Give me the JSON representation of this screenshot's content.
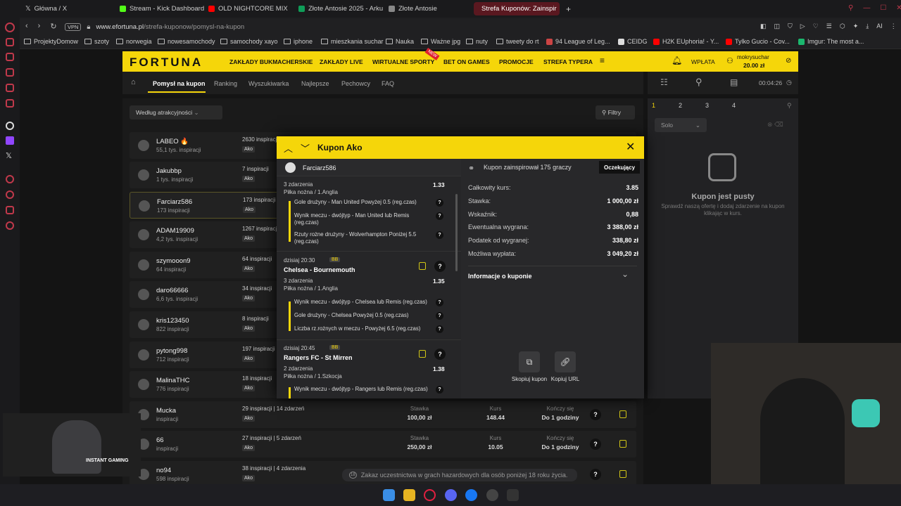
{
  "browser": {
    "tabs": [
      {
        "label": "Główna / X",
        "color": "#ffffff"
      },
      {
        "label": "Stream - Kick Dashboard",
        "color": "#53fc18"
      },
      {
        "label": "OLD NIGHTCORE MIX",
        "color": "#ff0000"
      },
      {
        "label": "Złote Antosie 2025 - Arku",
        "color": "#0f9d58"
      },
      {
        "label": "Złote Antosie",
        "color": "#888888"
      },
      {
        "label": "Strefa Kuponów: Zainspir",
        "color": "#e02020"
      }
    ],
    "new_tab": "+",
    "vpn": "VPN",
    "url_domain": "www.efortuna.pl",
    "url_path": "/strefa-kuponow/pomysl-na-kupon",
    "ai_label": "AI",
    "bookmarks": [
      "ProjektyDomow",
      "szoty",
      "norwegia",
      "nowesamochody",
      "samochody xayo",
      "iphone",
      "mieszkania suchar",
      "Nauka",
      "Ważne jpg",
      "nuty",
      "tweety do rt",
      "94 League of Leg...",
      "CEIDG",
      "H2K EUphoria! - Y...",
      "Tylko Gucio - Cov...",
      "Imgur: The most a..."
    ]
  },
  "site": {
    "logo": "FORTUNA",
    "nav": [
      "ZAKŁADY BUKMACHERSKIE",
      "ZAKŁADY LIVE",
      "WIRTUALNE SPORTY",
      "BET ON GAMES",
      "PROMOCJE",
      "STREFA TYPERA"
    ],
    "nav_badge": "NEW",
    "deposit": "WPŁATA",
    "username": "mokrysuchar",
    "balance": "20.00 zł",
    "subnav": [
      "Pomysł na kupon",
      "Ranking",
      "Wyszukiwarka",
      "Najlepsze",
      "Pechowcy",
      "FAQ"
    ],
    "timer": "00:04:26",
    "sort": "Według atrakcyjności",
    "filter": "Filtry"
  },
  "slip": {
    "tabs": [
      "1",
      "2",
      "3",
      "4"
    ],
    "mode": "Solo",
    "empty_title": "Kupon jest pusty",
    "empty_text": "Sprawdź naszą ofertę i dodaj zdarzenie na kupon klikając w kurs."
  },
  "list": [
    {
      "name": "LABEO 🔥",
      "sub": "55,1 tys. inspiracji",
      "insp": "2630 inspiracji"
    },
    {
      "name": "Jakubbp",
      "sub": "1 tys. inspiracji",
      "insp": "7 inspiracji"
    },
    {
      "name": "Farciarz586",
      "sub": "173 inspiracji",
      "insp": "173 inspiracji"
    },
    {
      "name": "ADAM19909",
      "sub": "4,2 tys. inspiracji",
      "insp": "1267 inspiracji"
    },
    {
      "name": "szymooon9",
      "sub": "64 inspiracji",
      "insp": "64 inspiracji"
    },
    {
      "name": "daro66666",
      "sub": "6,6 tys. inspiracji",
      "insp": "34 inspiracji"
    },
    {
      "name": "kris123450",
      "sub": "822 inspiracji",
      "insp": "8 inspiracji"
    },
    {
      "name": "pytong998",
      "sub": "712 inspiracji",
      "insp": "197 inspiracji"
    },
    {
      "name": "MalinaTHC",
      "sub": "776 inspiracji",
      "insp": "18 inspiracji"
    },
    {
      "name": "Mucka",
      "sub": "inspiracji",
      "insp": "29 inspiracji",
      "events": "14 zdarzeń",
      "stake": "100,00 zł",
      "odds": "148.44",
      "ends": "Do 1 godziny"
    },
    {
      "name": "66",
      "sub": "inspiracji",
      "insp": "27 inspiracji",
      "events": "5 zdarzeń",
      "stake": "250,00 zł",
      "odds": "10.05",
      "ends": "Do 1 godziny"
    },
    {
      "name": "no94",
      "sub": "598 inspiracji",
      "insp": "38 inspiracji",
      "events": "4 zdarzenia",
      "stake": "",
      "odds": "",
      "ends": ""
    }
  ],
  "ako_tag": "Ako",
  "col_labels": {
    "stake": "Stawka",
    "odds": "Kurs",
    "ends": "Kończy się"
  },
  "modal": {
    "title": "Kupon Ako",
    "user": "Farciarz586",
    "inspired": "Kupon zainspirował 175 graczy",
    "status": "Oczekujący",
    "match1": {
      "events": "3 zdarzenia",
      "league": "Piłka nożna / 1.Anglia",
      "odds": "1.33",
      "bets": [
        "Gole drużyny - Man United Powyżej 0.5 (reg.czas)",
        "Wynik meczu - dwójtyp - Man United lub Remis (reg.czas)",
        "Rzuty rożne drużyny - Wolverhampton Poniżej 5.5 (reg.czas)"
      ]
    },
    "match2": {
      "time": "dzisiaj 20:30",
      "bb": "BB",
      "title": "Chelsea - Bournemouth",
      "events": "3 zdarzenia",
      "league": "Piłka nożna / 1.Anglia",
      "odds": "1.35",
      "bets": [
        "Wynik meczu - dwójtyp - Chelsea lub Remis (reg.czas)",
        "Gole drużyny - Chelsea Powyżej 0.5 (reg.czas)",
        "Liczba rz.rożnych w meczu - Powyżej 6.5 (reg.czas)"
      ]
    },
    "match3": {
      "time": "dzisiaj 20:45",
      "bb": "BB",
      "title": "Rangers FC - St Mirren",
      "events": "2 zdarzenia",
      "league": "Piłka nożna / 1.Szkocja",
      "odds": "1.38",
      "bets": [
        "Wynik meczu - dwójtyp - Rangers lub Remis (reg.czas)"
      ]
    },
    "summary": [
      {
        "k": "Całkowity kurs:",
        "v": "3.85"
      },
      {
        "k": "Stawka:",
        "v": "1 000,00 zł"
      },
      {
        "k": "Wskaźnik:",
        "v": "0,88"
      },
      {
        "k": "Ewentualna wygrana:",
        "v": "3 388,00 zł"
      },
      {
        "k": "Podatek od wygranej:",
        "v": "338,80 zł"
      },
      {
        "k": "Możliwa wypłata:",
        "v": "3 049,20 zł"
      }
    ],
    "info": "Informacje o kuponie",
    "copy_coupon": "Skopiuj kupon",
    "copy_url": "Kopiuj URL"
  },
  "legal": "Zakaz uczestnictwa w grach hazardowych dla osób poniżej 18 roku życia.",
  "legal_badge": "18",
  "overlay": {
    "brand": "INSTANT GAMING"
  }
}
